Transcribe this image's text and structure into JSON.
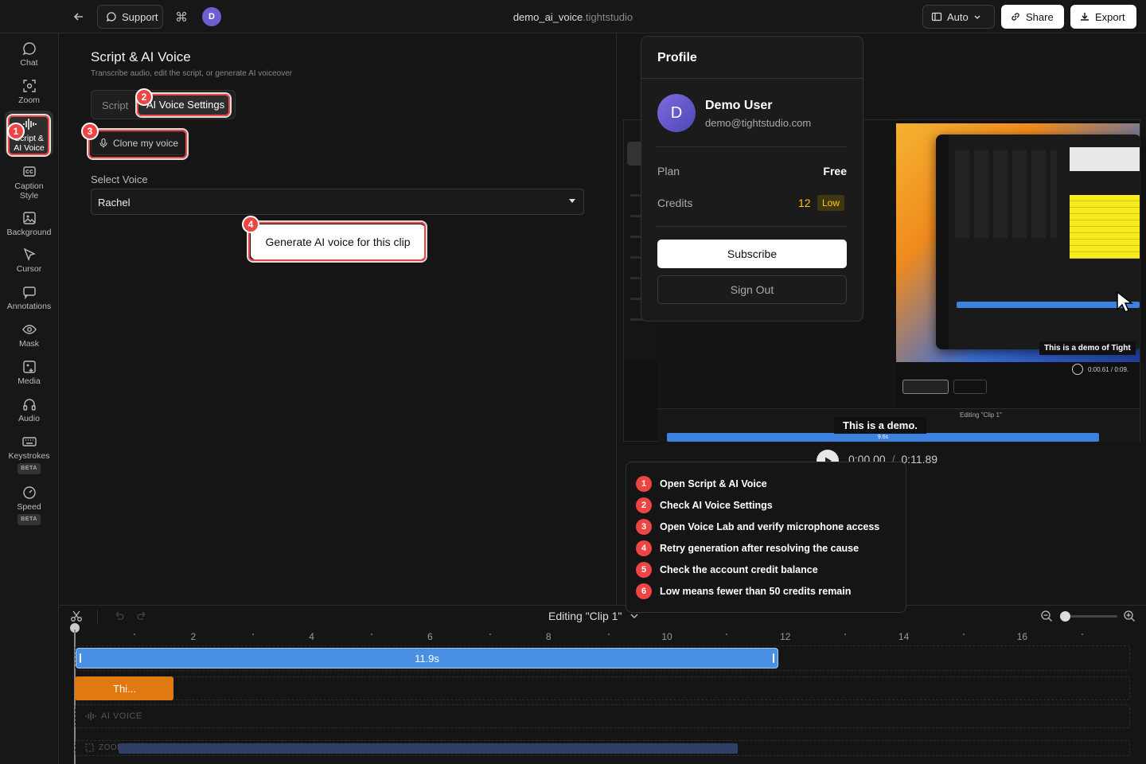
{
  "topbar": {
    "support": "Support",
    "avatar": "D",
    "filename": "demo_ai_voice",
    "filename_suffix": ".tightstudio",
    "auto": "Auto",
    "share": "Share",
    "export": "Export"
  },
  "sidebar": [
    {
      "label": "Chat",
      "icon": "chat-bubble-icon"
    },
    {
      "label": "Zoom",
      "icon": "zoom-icon"
    },
    {
      "label": "Script & AI Voice",
      "icon": "waveform-icon"
    },
    {
      "label": "Caption Style",
      "icon": "caption-icon"
    },
    {
      "label": "Background",
      "icon": "image-icon"
    },
    {
      "label": "Cursor",
      "icon": "cursor-icon"
    },
    {
      "label": "Annotations",
      "icon": "annotation-icon"
    },
    {
      "label": "Mask",
      "icon": "eye-icon"
    },
    {
      "label": "Media",
      "icon": "media-icon"
    },
    {
      "label": "Audio",
      "icon": "headphones-icon"
    },
    {
      "label": "Keystrokes",
      "icon": "keyboard-icon",
      "badge": "BETA"
    },
    {
      "label": "Speed",
      "icon": "gauge-icon",
      "badge": "BETA"
    }
  ],
  "panel": {
    "title": "Script & AI Voice",
    "subtitle": "Transcribe audio, edit the script, or generate AI voiceover",
    "tabs": [
      "Script",
      "AI Voice Settings"
    ],
    "clone_button": "Clone my voice",
    "select_label": "Select Voice",
    "select_value": "Rachel",
    "generate_button": "Generate AI voice for this clip"
  },
  "profile": {
    "title": "Profile",
    "avatar": "D",
    "name": "Demo User",
    "email": "demo@tightstudio.com",
    "plan_label": "Plan",
    "plan_value": "Free",
    "credits_label": "Credits",
    "credits_value": "12",
    "credits_status": "Low",
    "subscribe": "Subscribe",
    "sign_out": "Sign Out"
  },
  "preview": {
    "caption": "This is a demo.",
    "time_current": "0:00.00",
    "time_sep": "/",
    "time_total": "0:11.89",
    "inner_caption": "This is a demo of Tight",
    "inner_time": "0:00.61 / 0:09.",
    "inner_editing": "Editing \"Clip 1\"",
    "inner_clip_len": "9.6s"
  },
  "guide": [
    {
      "n": "1",
      "text": "Open Script & AI Voice"
    },
    {
      "n": "2",
      "text": "Check AI Voice Settings"
    },
    {
      "n": "3",
      "text": "Open Voice Lab and verify microphone access"
    },
    {
      "n": "4",
      "text": "Retry generation after resolving the cause"
    },
    {
      "n": "5",
      "text": "Check the account credit balance"
    },
    {
      "n": "6",
      "text": "Low means fewer than 50 credits remain"
    }
  ],
  "badges": [
    "1",
    "2",
    "3",
    "4",
    "5",
    "6"
  ],
  "timeline": {
    "editing": "Editing \"Clip 1\"",
    "ticks": [
      "2",
      "4",
      "6",
      "8",
      "10",
      "12",
      "14",
      "16"
    ],
    "clip_length": "11.9s",
    "caption_clip": "Thi...",
    "ai_voice_label": "AI VOICE",
    "zoom_label": "ZOOM",
    "zoom_slider_level": 0.0
  },
  "colors": {
    "accent_blue": "#4a90e2",
    "badge_red": "#ef4444",
    "caption_orange": "#e07a10",
    "low_yellow": "#facc15",
    "avatar_purple": "#6d5fd0"
  }
}
